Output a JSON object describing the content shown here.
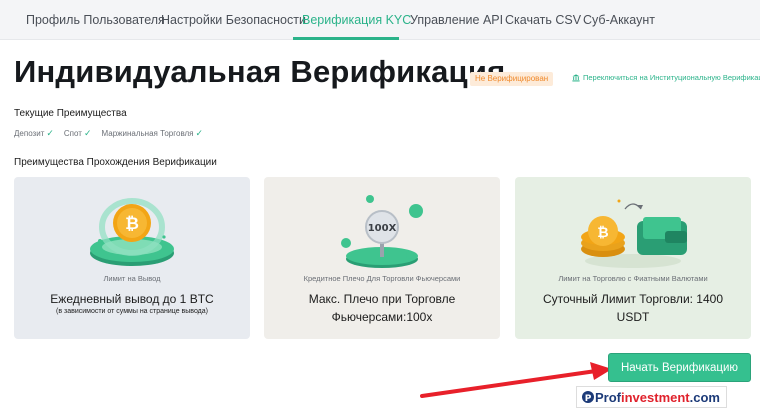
{
  "tabs": [
    {
      "label": "Профиль Пользователя",
      "active": false
    },
    {
      "label": "Настройки Безопасности",
      "active": false
    },
    {
      "label": "Верификация KYC",
      "active": true
    },
    {
      "label": "Управление API",
      "active": false
    },
    {
      "label": "Скачать CSV",
      "active": false
    },
    {
      "label": "Суб-Аккаунт",
      "active": false
    }
  ],
  "page": {
    "title": "Индивидуальная Верификация",
    "status_badge": "Не Верифицирован",
    "institutional_link": "Переключиться на Институциональную Верификацию"
  },
  "current_benefits": {
    "label": "Текущие Преимущества",
    "items": [
      "Депозит",
      "Спот",
      "Маржинальная Торговля"
    ]
  },
  "verification_benefits": {
    "label": "Преимущества Прохождения Верификации",
    "cards": [
      {
        "caption": "Лимит на Вывод",
        "main": "Ежедневный вывод до 1 BTC",
        "sub": "(в зависимости от суммы на странице вывода)",
        "bg": "#e8ebf0"
      },
      {
        "caption": "Кредитное Плечо Для Торговли Фьючерсами",
        "main": "Макс. Плечо при Торговле Фьючерсами:100x",
        "sub": "",
        "badge": "100X",
        "bg": "#f0eeea"
      },
      {
        "caption": "Лимит на Торговлю с Фиатными Валютами",
        "main": "Суточный Лимит Торговли: 1400 USDT",
        "sub": "",
        "bg": "#e6efe4"
      }
    ]
  },
  "actions": {
    "start_label": "Начать Верификацию"
  },
  "watermark": {
    "part1": "Prof",
    "part2": "investment",
    "part3": ".com"
  },
  "colors": {
    "accent": "#2bb38a",
    "button": "#35c08f",
    "badge_text": "#f08a2c",
    "arrow": "#e8202a"
  },
  "icons": {
    "institution": "bank-icon",
    "check": "check-icon",
    "coin": "bitcoin-coin-icon",
    "wallet": "wallet-icon"
  }
}
